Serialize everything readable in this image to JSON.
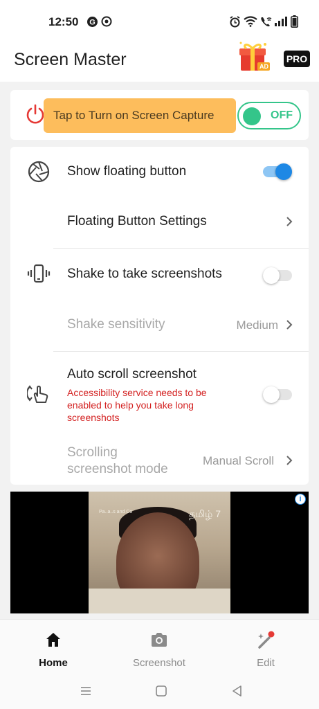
{
  "status_bar": {
    "time": "12:50",
    "left_icons": [
      "g-logo-icon",
      "notification-app-icon"
    ],
    "right_icons": [
      "alarm-icon",
      "wifi-icon",
      "wifi-call-icon",
      "signal-icon",
      "battery-icon"
    ]
  },
  "app_bar": {
    "title": "Screen Master",
    "gift_badge": "AD",
    "pro_label": "PRO"
  },
  "capture": {
    "tooltip": "Tap to Turn on Screen Capture",
    "toggle_label": "OFF",
    "toggle_color": "#34c58a"
  },
  "settings": {
    "show_floating": {
      "label": "Show floating button",
      "enabled": true
    },
    "floating_settings": {
      "label": "Floating Button Settings"
    },
    "shake": {
      "label": "Shake to take screenshots",
      "enabled": false
    },
    "shake_sensitivity": {
      "label": "Shake sensitivity",
      "value": "Medium"
    },
    "auto_scroll": {
      "label": "Auto scroll screenshot",
      "warning": "Accessibility service needs to be enabled to help you take long screenshots",
      "enabled": false
    },
    "scrolling_mode": {
      "label_line1": "Scrolling",
      "label_line2": "screenshot mode",
      "value": "Manual Scroll"
    }
  },
  "ad": {
    "caption_small": "Pa..a..s and Co",
    "caption_right": "தமிழ் 7",
    "info_label": "i"
  },
  "bottom_nav": {
    "items": [
      {
        "label": "Home",
        "icon": "home-icon",
        "active": true
      },
      {
        "label": "Screenshot",
        "icon": "camera-icon",
        "active": false
      },
      {
        "label": "Edit",
        "icon": "magic-wand-icon",
        "active": false
      }
    ]
  },
  "colors": {
    "accent_blue": "#1e88e5",
    "tooltip_bg": "#fdbd5c",
    "warning_red": "#d32020"
  }
}
